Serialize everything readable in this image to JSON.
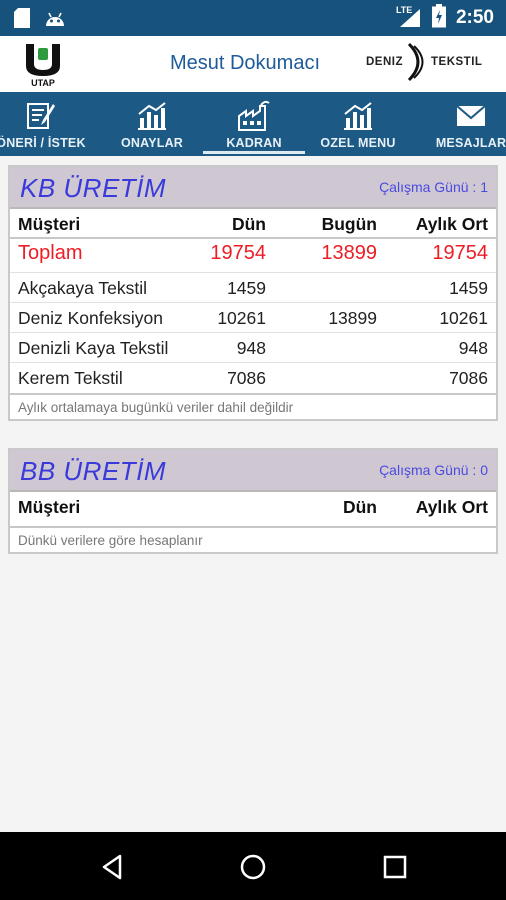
{
  "status_bar": {
    "time": "2:50",
    "network": "LTE",
    "icons": [
      "sd-card-icon",
      "android-icon",
      "signal-icon",
      "battery-icon"
    ]
  },
  "header": {
    "logo_left_text": "UTAP",
    "title": "Mesut Dokumacı",
    "logo_right_word1": "DENIZ",
    "logo_right_word2": "TEKSTIL"
  },
  "nav": {
    "tabs": [
      {
        "label": "ÖNERİ / İSTEK",
        "icon": "edit-icon",
        "active": false
      },
      {
        "label": "ONAYLAR",
        "icon": "bar-chart-icon",
        "active": false
      },
      {
        "label": "KADRAN",
        "icon": "factory-icon",
        "active": true
      },
      {
        "label": "OZEL MENU",
        "icon": "bar-chart-icon",
        "active": false
      },
      {
        "label": "MESAJLAR",
        "icon": "envelope-icon",
        "active": false
      }
    ]
  },
  "kb": {
    "title": "KB ÜRETİM",
    "days": "Çalışma Günü : 1",
    "columns": {
      "name": "Müşteri",
      "yesterday": "Dün",
      "today": "Bugün",
      "monthly": "Aylık Ort"
    },
    "total": {
      "name": "Toplam",
      "yesterday": "19754",
      "today": "13899",
      "monthly": "19754"
    },
    "rows": [
      {
        "name": "Akçakaya Tekstil",
        "yesterday": "1459",
        "today": "",
        "monthly": "1459"
      },
      {
        "name": "Deniz Konfeksiyon",
        "yesterday": "10261",
        "today": "13899",
        "monthly": "10261"
      },
      {
        "name": "Denizli Kaya Tekstil",
        "yesterday": "948",
        "today": "",
        "monthly": "948"
      },
      {
        "name": "Kerem Tekstil",
        "yesterday": "7086",
        "today": "",
        "monthly": "7086"
      }
    ],
    "note": "Aylık ortalamaya bugünkü veriler dahil değildir"
  },
  "bb": {
    "title": "BB ÜRETİM",
    "days": "Çalışma Günü : 0",
    "columns": {
      "name": "Müşteri",
      "yesterday": "Dün",
      "monthly": "Aylık Ort"
    },
    "note": "Dünkü verilere göre hesaplanır"
  },
  "colors": {
    "status_bar": "#17527d",
    "nav_bar": "#1c5a85",
    "card_header": "#cfc8d3",
    "title_blue": "#3a3adb",
    "total_red": "#ee1c25"
  }
}
